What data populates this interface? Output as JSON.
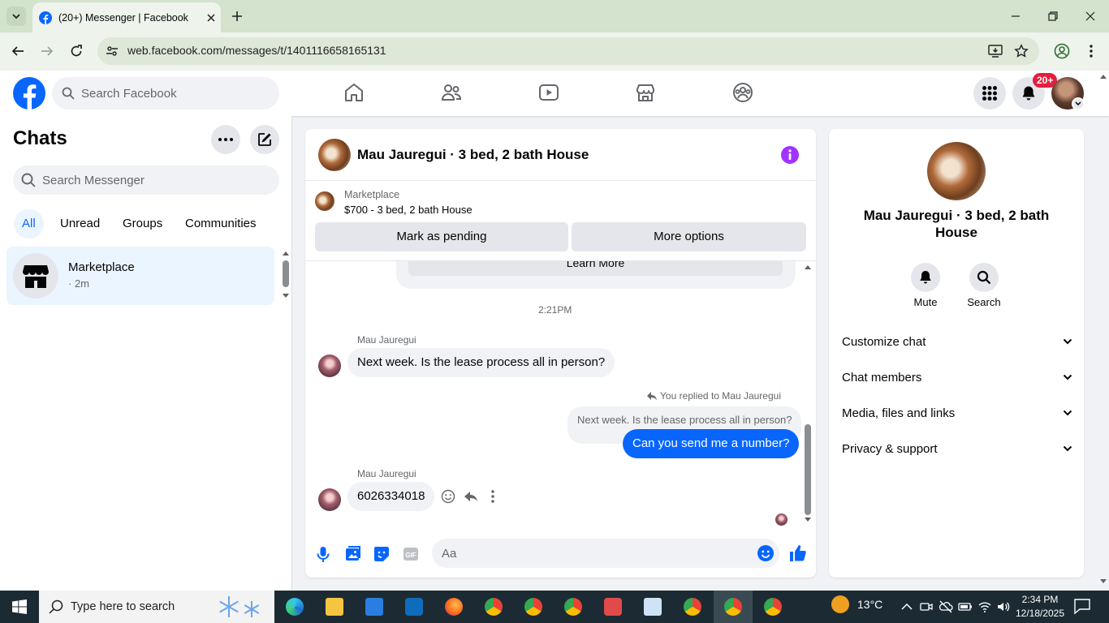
{
  "browser": {
    "tab_title": "(20+) Messenger | Facebook",
    "url": "web.facebook.com/messages/t/1401116658165131"
  },
  "facebook": {
    "search_placeholder": "Search Facebook",
    "notification_badge": "20+"
  },
  "chats": {
    "title": "Chats",
    "search_placeholder": "Search Messenger",
    "filters": [
      {
        "label": "All",
        "active": true
      },
      {
        "label": "Unread",
        "active": false
      },
      {
        "label": "Groups",
        "active": false
      },
      {
        "label": "Communities",
        "active": false
      }
    ],
    "conversations": [
      {
        "name": "Marketplace",
        "time": "· 2m"
      }
    ]
  },
  "conversation": {
    "title": "Mau Jauregui · 3 bed, 2 bath House",
    "marketplace_label": "Marketplace",
    "listing": "$700 - 3 bed, 2 bath House",
    "mark_pending_label": "Mark as pending",
    "more_options_label": "More options",
    "learn_more_label": "Learn More",
    "timestamp": "2:21PM",
    "messages": [
      {
        "sender": "Mau Jauregui",
        "text": "Next week. Is the lease process all in person?"
      },
      {
        "replied_label": "You replied to Mau Jauregui",
        "quoted": "Next week. Is the lease process all in person?",
        "text": "Can you send me a number?"
      },
      {
        "sender": "Mau Jauregui",
        "text": "6026334018"
      }
    ],
    "composer_placeholder": "Aa"
  },
  "info_panel": {
    "name": "Mau Jauregui · 3 bed, 2 bath House",
    "actions": [
      {
        "label": "Mute",
        "icon": "bell-icon"
      },
      {
        "label": "Search",
        "icon": "search-icon"
      }
    ],
    "sections": [
      "Customize chat",
      "Chat members",
      "Media, files and links",
      "Privacy & support"
    ]
  },
  "taskbar": {
    "search_placeholder": "Type here to search",
    "weather": "13°C",
    "time": "2:34 PM",
    "date": "12/18/2025"
  },
  "colors": {
    "accent": "#0866ff",
    "messenger_purple": "#a033ff",
    "badge_red": "#e41e3f"
  }
}
